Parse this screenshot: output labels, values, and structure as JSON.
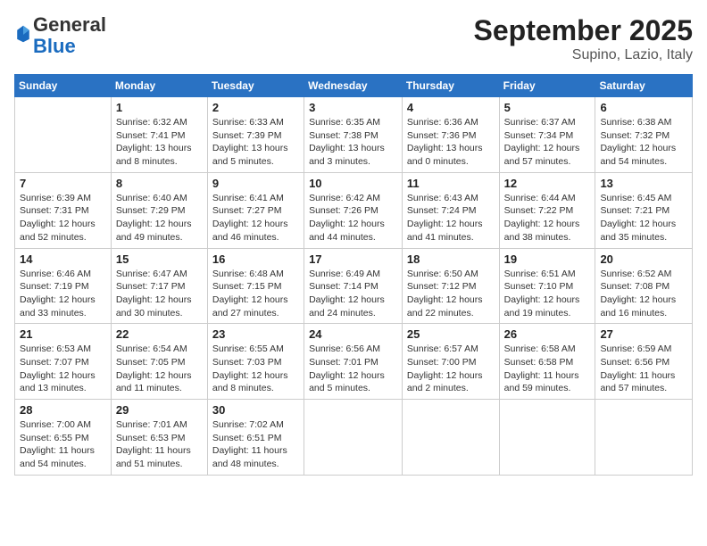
{
  "logo": {
    "general": "General",
    "blue": "Blue"
  },
  "title": "September 2025",
  "location": "Supino, Lazio, Italy",
  "days_header": [
    "Sunday",
    "Monday",
    "Tuesday",
    "Wednesday",
    "Thursday",
    "Friday",
    "Saturday"
  ],
  "weeks": [
    [
      {
        "day": "",
        "info": ""
      },
      {
        "day": "1",
        "info": "Sunrise: 6:32 AM\nSunset: 7:41 PM\nDaylight: 13 hours\nand 8 minutes."
      },
      {
        "day": "2",
        "info": "Sunrise: 6:33 AM\nSunset: 7:39 PM\nDaylight: 13 hours\nand 5 minutes."
      },
      {
        "day": "3",
        "info": "Sunrise: 6:35 AM\nSunset: 7:38 PM\nDaylight: 13 hours\nand 3 minutes."
      },
      {
        "day": "4",
        "info": "Sunrise: 6:36 AM\nSunset: 7:36 PM\nDaylight: 13 hours\nand 0 minutes."
      },
      {
        "day": "5",
        "info": "Sunrise: 6:37 AM\nSunset: 7:34 PM\nDaylight: 12 hours\nand 57 minutes."
      },
      {
        "day": "6",
        "info": "Sunrise: 6:38 AM\nSunset: 7:32 PM\nDaylight: 12 hours\nand 54 minutes."
      }
    ],
    [
      {
        "day": "7",
        "info": "Sunrise: 6:39 AM\nSunset: 7:31 PM\nDaylight: 12 hours\nand 52 minutes."
      },
      {
        "day": "8",
        "info": "Sunrise: 6:40 AM\nSunset: 7:29 PM\nDaylight: 12 hours\nand 49 minutes."
      },
      {
        "day": "9",
        "info": "Sunrise: 6:41 AM\nSunset: 7:27 PM\nDaylight: 12 hours\nand 46 minutes."
      },
      {
        "day": "10",
        "info": "Sunrise: 6:42 AM\nSunset: 7:26 PM\nDaylight: 12 hours\nand 44 minutes."
      },
      {
        "day": "11",
        "info": "Sunrise: 6:43 AM\nSunset: 7:24 PM\nDaylight: 12 hours\nand 41 minutes."
      },
      {
        "day": "12",
        "info": "Sunrise: 6:44 AM\nSunset: 7:22 PM\nDaylight: 12 hours\nand 38 minutes."
      },
      {
        "day": "13",
        "info": "Sunrise: 6:45 AM\nSunset: 7:21 PM\nDaylight: 12 hours\nand 35 minutes."
      }
    ],
    [
      {
        "day": "14",
        "info": "Sunrise: 6:46 AM\nSunset: 7:19 PM\nDaylight: 12 hours\nand 33 minutes."
      },
      {
        "day": "15",
        "info": "Sunrise: 6:47 AM\nSunset: 7:17 PM\nDaylight: 12 hours\nand 30 minutes."
      },
      {
        "day": "16",
        "info": "Sunrise: 6:48 AM\nSunset: 7:15 PM\nDaylight: 12 hours\nand 27 minutes."
      },
      {
        "day": "17",
        "info": "Sunrise: 6:49 AM\nSunset: 7:14 PM\nDaylight: 12 hours\nand 24 minutes."
      },
      {
        "day": "18",
        "info": "Sunrise: 6:50 AM\nSunset: 7:12 PM\nDaylight: 12 hours\nand 22 minutes."
      },
      {
        "day": "19",
        "info": "Sunrise: 6:51 AM\nSunset: 7:10 PM\nDaylight: 12 hours\nand 19 minutes."
      },
      {
        "day": "20",
        "info": "Sunrise: 6:52 AM\nSunset: 7:08 PM\nDaylight: 12 hours\nand 16 minutes."
      }
    ],
    [
      {
        "day": "21",
        "info": "Sunrise: 6:53 AM\nSunset: 7:07 PM\nDaylight: 12 hours\nand 13 minutes."
      },
      {
        "day": "22",
        "info": "Sunrise: 6:54 AM\nSunset: 7:05 PM\nDaylight: 12 hours\nand 11 minutes."
      },
      {
        "day": "23",
        "info": "Sunrise: 6:55 AM\nSunset: 7:03 PM\nDaylight: 12 hours\nand 8 minutes."
      },
      {
        "day": "24",
        "info": "Sunrise: 6:56 AM\nSunset: 7:01 PM\nDaylight: 12 hours\nand 5 minutes."
      },
      {
        "day": "25",
        "info": "Sunrise: 6:57 AM\nSunset: 7:00 PM\nDaylight: 12 hours\nand 2 minutes."
      },
      {
        "day": "26",
        "info": "Sunrise: 6:58 AM\nSunset: 6:58 PM\nDaylight: 11 hours\nand 59 minutes."
      },
      {
        "day": "27",
        "info": "Sunrise: 6:59 AM\nSunset: 6:56 PM\nDaylight: 11 hours\nand 57 minutes."
      }
    ],
    [
      {
        "day": "28",
        "info": "Sunrise: 7:00 AM\nSunset: 6:55 PM\nDaylight: 11 hours\nand 54 minutes."
      },
      {
        "day": "29",
        "info": "Sunrise: 7:01 AM\nSunset: 6:53 PM\nDaylight: 11 hours\nand 51 minutes."
      },
      {
        "day": "30",
        "info": "Sunrise: 7:02 AM\nSunset: 6:51 PM\nDaylight: 11 hours\nand 48 minutes."
      },
      {
        "day": "",
        "info": ""
      },
      {
        "day": "",
        "info": ""
      },
      {
        "day": "",
        "info": ""
      },
      {
        "day": "",
        "info": ""
      }
    ]
  ]
}
